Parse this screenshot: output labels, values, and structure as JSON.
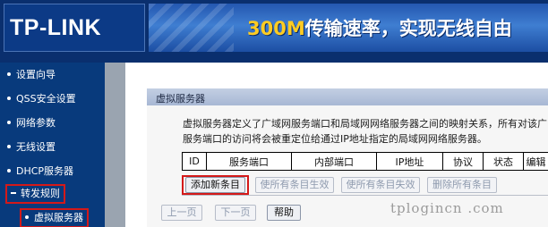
{
  "header": {
    "logo": "TP-LINK",
    "banner_accent": "300M",
    "banner_text": "传输速率，实现无线自由"
  },
  "sidebar": {
    "items": [
      {
        "label": "设置向导"
      },
      {
        "label": "QSS安全设置"
      },
      {
        "label": "网络参数"
      },
      {
        "label": "无线设置"
      },
      {
        "label": "DHCP服务器"
      },
      {
        "label": "转发规则"
      },
      {
        "label": "虚拟服务器"
      }
    ]
  },
  "panel": {
    "title": "虚拟服务器",
    "description_line1": "虚拟服务器定义了广域网服务端口和局域网网络服务器之间的映射关系，所有对该广",
    "description_line2": "服务端口的访问将会被重定位给通过IP地址指定的局域网网络服务器。",
    "table": {
      "headers": [
        "ID",
        "服务端口",
        "内部端口",
        "IP地址",
        "协议",
        "状态",
        "编辑"
      ]
    },
    "buttons": {
      "add": "添加新条目",
      "enable_all": "使所有条目生效",
      "disable_all": "使所有条目失效",
      "delete_all": "删除所有条目"
    },
    "pager": {
      "prev": "上一页",
      "next": "下一页",
      "help": "帮助"
    }
  },
  "watermark": "tplogincn .com",
  "colors": {
    "header_bg": "#0a2f6e",
    "sidebar_bg": "#083a7c",
    "highlight_border": "#d41919",
    "banner_accent": "#ffcc22"
  }
}
